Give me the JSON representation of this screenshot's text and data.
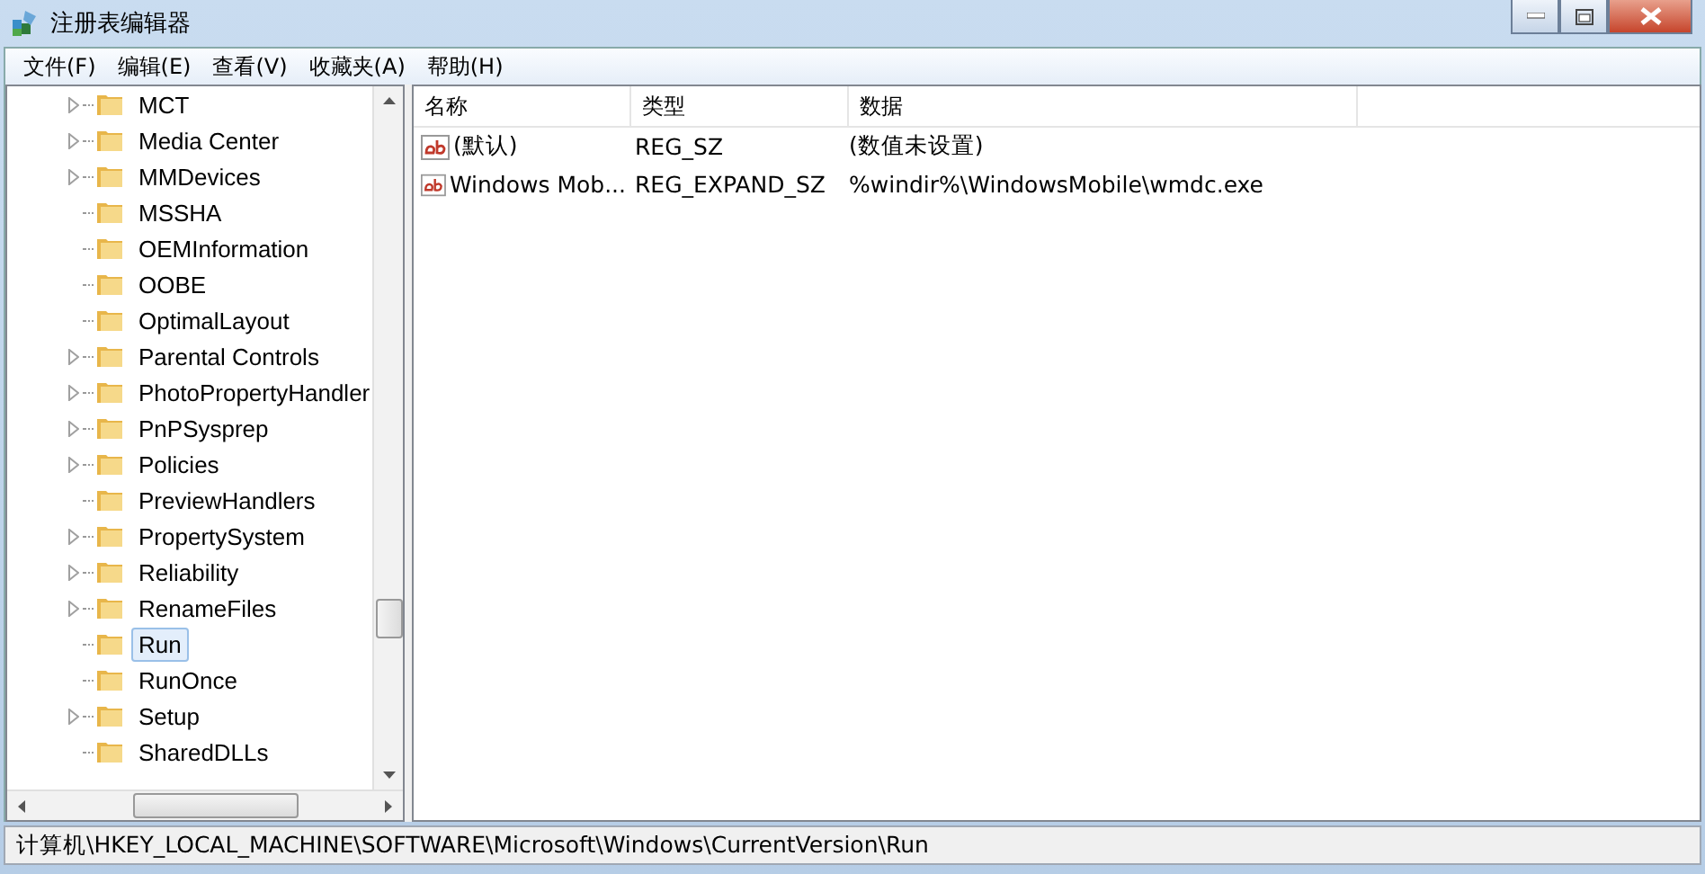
{
  "window": {
    "title": "注册表编辑器"
  },
  "menu": [
    "文件(F)",
    "编辑(E)",
    "查看(V)",
    "收藏夹(A)",
    "帮助(H)"
  ],
  "tree": [
    {
      "label": "MCT",
      "expandable": true,
      "selected": false
    },
    {
      "label": "Media Center",
      "expandable": true,
      "selected": false
    },
    {
      "label": "MMDevices",
      "expandable": true,
      "selected": false
    },
    {
      "label": "MSSHA",
      "expandable": false,
      "selected": false
    },
    {
      "label": "OEMInformation",
      "expandable": false,
      "selected": false
    },
    {
      "label": "OOBE",
      "expandable": false,
      "selected": false
    },
    {
      "label": "OptimalLayout",
      "expandable": false,
      "selected": false
    },
    {
      "label": "Parental Controls",
      "expandable": true,
      "selected": false
    },
    {
      "label": "PhotoPropertyHandler",
      "expandable": true,
      "selected": false
    },
    {
      "label": "PnPSysprep",
      "expandable": true,
      "selected": false
    },
    {
      "label": "Policies",
      "expandable": true,
      "selected": false
    },
    {
      "label": "PreviewHandlers",
      "expandable": false,
      "selected": false
    },
    {
      "label": "PropertySystem",
      "expandable": true,
      "selected": false
    },
    {
      "label": "Reliability",
      "expandable": true,
      "selected": false
    },
    {
      "label": "RenameFiles",
      "expandable": true,
      "selected": false
    },
    {
      "label": "Run",
      "expandable": false,
      "selected": true
    },
    {
      "label": "RunOnce",
      "expandable": false,
      "selected": false
    },
    {
      "label": "Setup",
      "expandable": true,
      "selected": false
    },
    {
      "label": "SharedDLLs",
      "expandable": false,
      "selected": false
    }
  ],
  "table": {
    "columns": [
      "名称",
      "类型",
      "数据"
    ],
    "rows": [
      {
        "name": "(默认)",
        "type": "REG_SZ",
        "data": "(数值未设置)"
      },
      {
        "name": "Windows Mob...",
        "type": "REG_EXPAND_SZ",
        "data": "%windir%\\WindowsMobile\\wmdc.exe"
      }
    ]
  },
  "status_bar": "计算机\\HKEY_LOCAL_MACHINE\\SOFTWARE\\Microsoft\\Windows\\CurrentVersion\\Run"
}
